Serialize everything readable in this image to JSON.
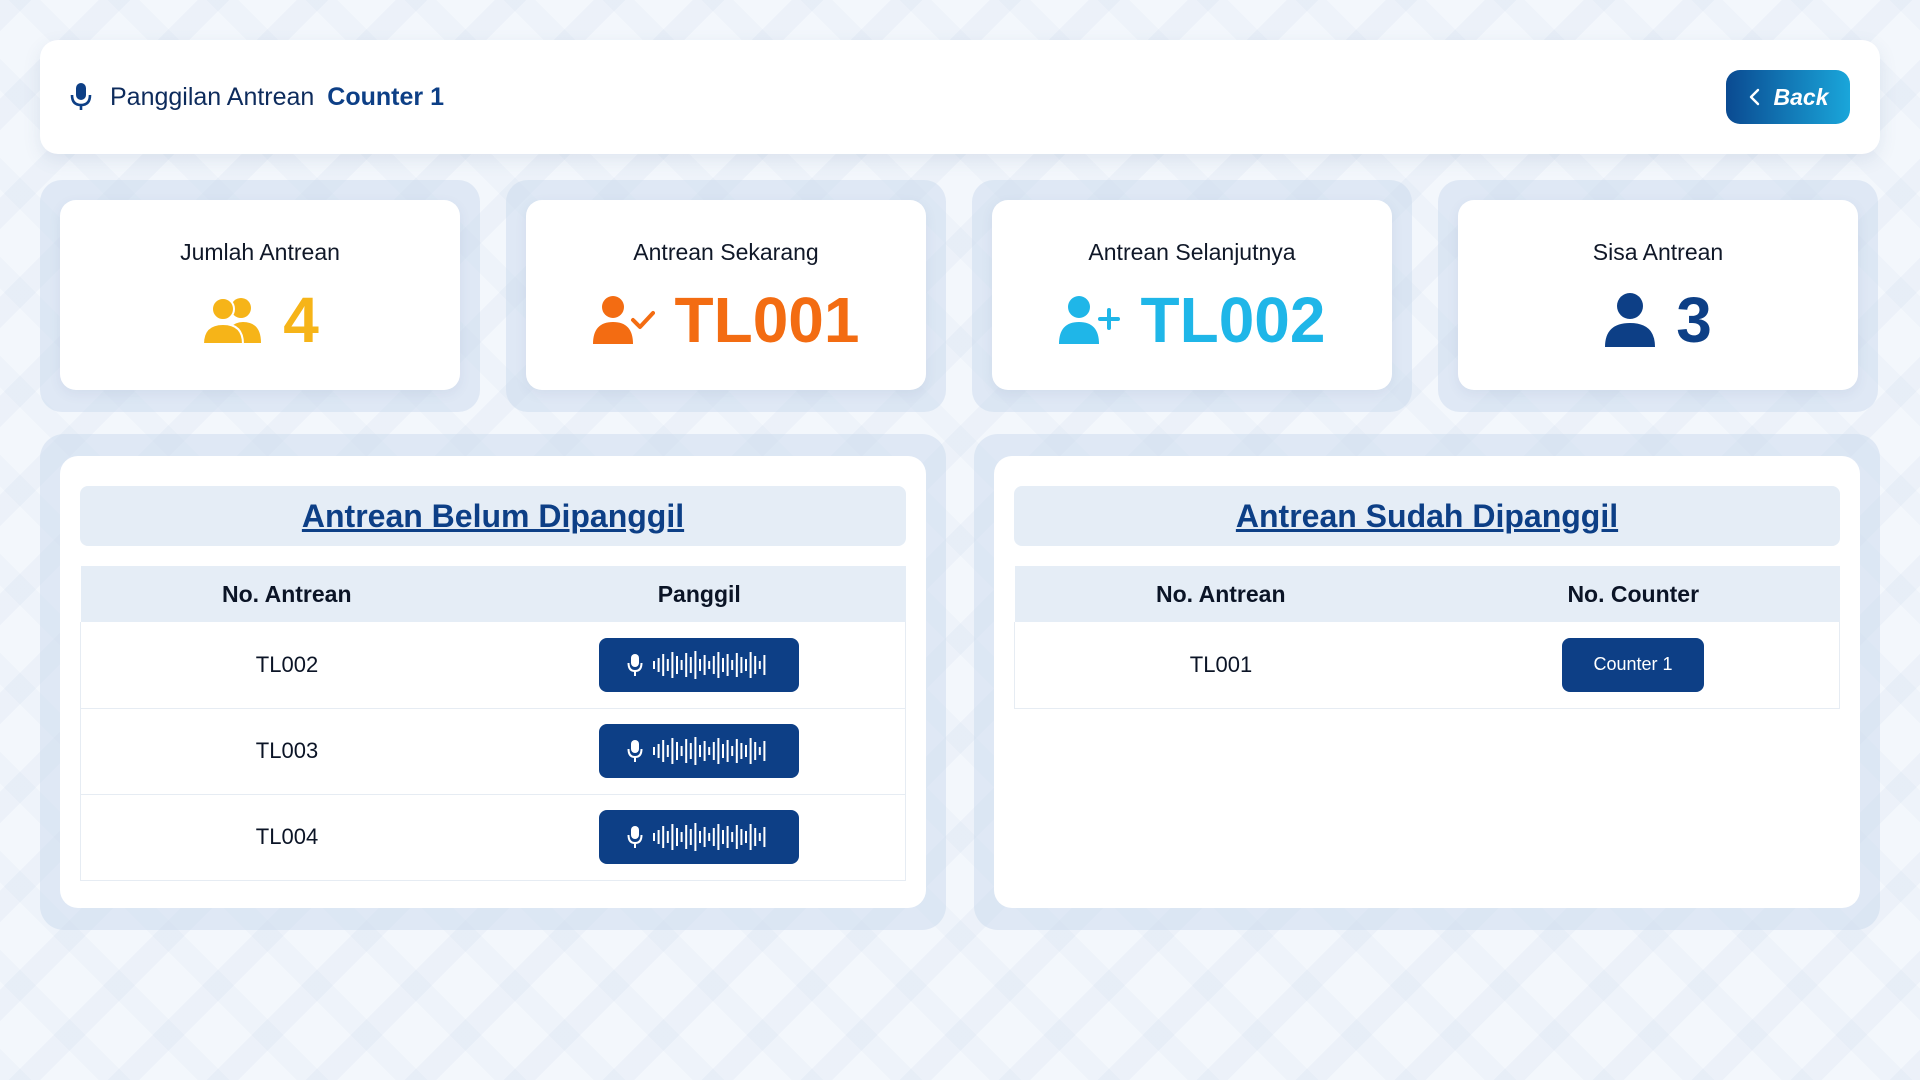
{
  "header": {
    "title_prefix": "Panggilan Antrean",
    "title_counter": "Counter 1",
    "back_label": "Back"
  },
  "stats": [
    {
      "label": "Jumlah Antrean",
      "value": "4",
      "icon": "users-icon",
      "color": "#f6b418"
    },
    {
      "label": "Antrean Sekarang",
      "value": "TL001",
      "icon": "user-check-icon",
      "color": "#f36c12"
    },
    {
      "label": "Antrean Selanjutnya",
      "value": "TL002",
      "icon": "user-plus-icon",
      "color": "#1fb6e8"
    },
    {
      "label": "Sisa Antrean",
      "value": "3",
      "icon": "user-icon",
      "color": "#0d3f86"
    }
  ],
  "pending": {
    "title": "Antrean Belum Dipanggil",
    "col_number": "No. Antrean",
    "col_call": "Panggil",
    "rows": [
      {
        "number": "TL002"
      },
      {
        "number": "TL003"
      },
      {
        "number": "TL004"
      }
    ]
  },
  "called": {
    "title": "Antrean Sudah Dipanggil",
    "col_number": "No. Antrean",
    "col_counter": "No. Counter",
    "rows": [
      {
        "number": "TL001",
        "counter": "Counter 1"
      }
    ]
  }
}
